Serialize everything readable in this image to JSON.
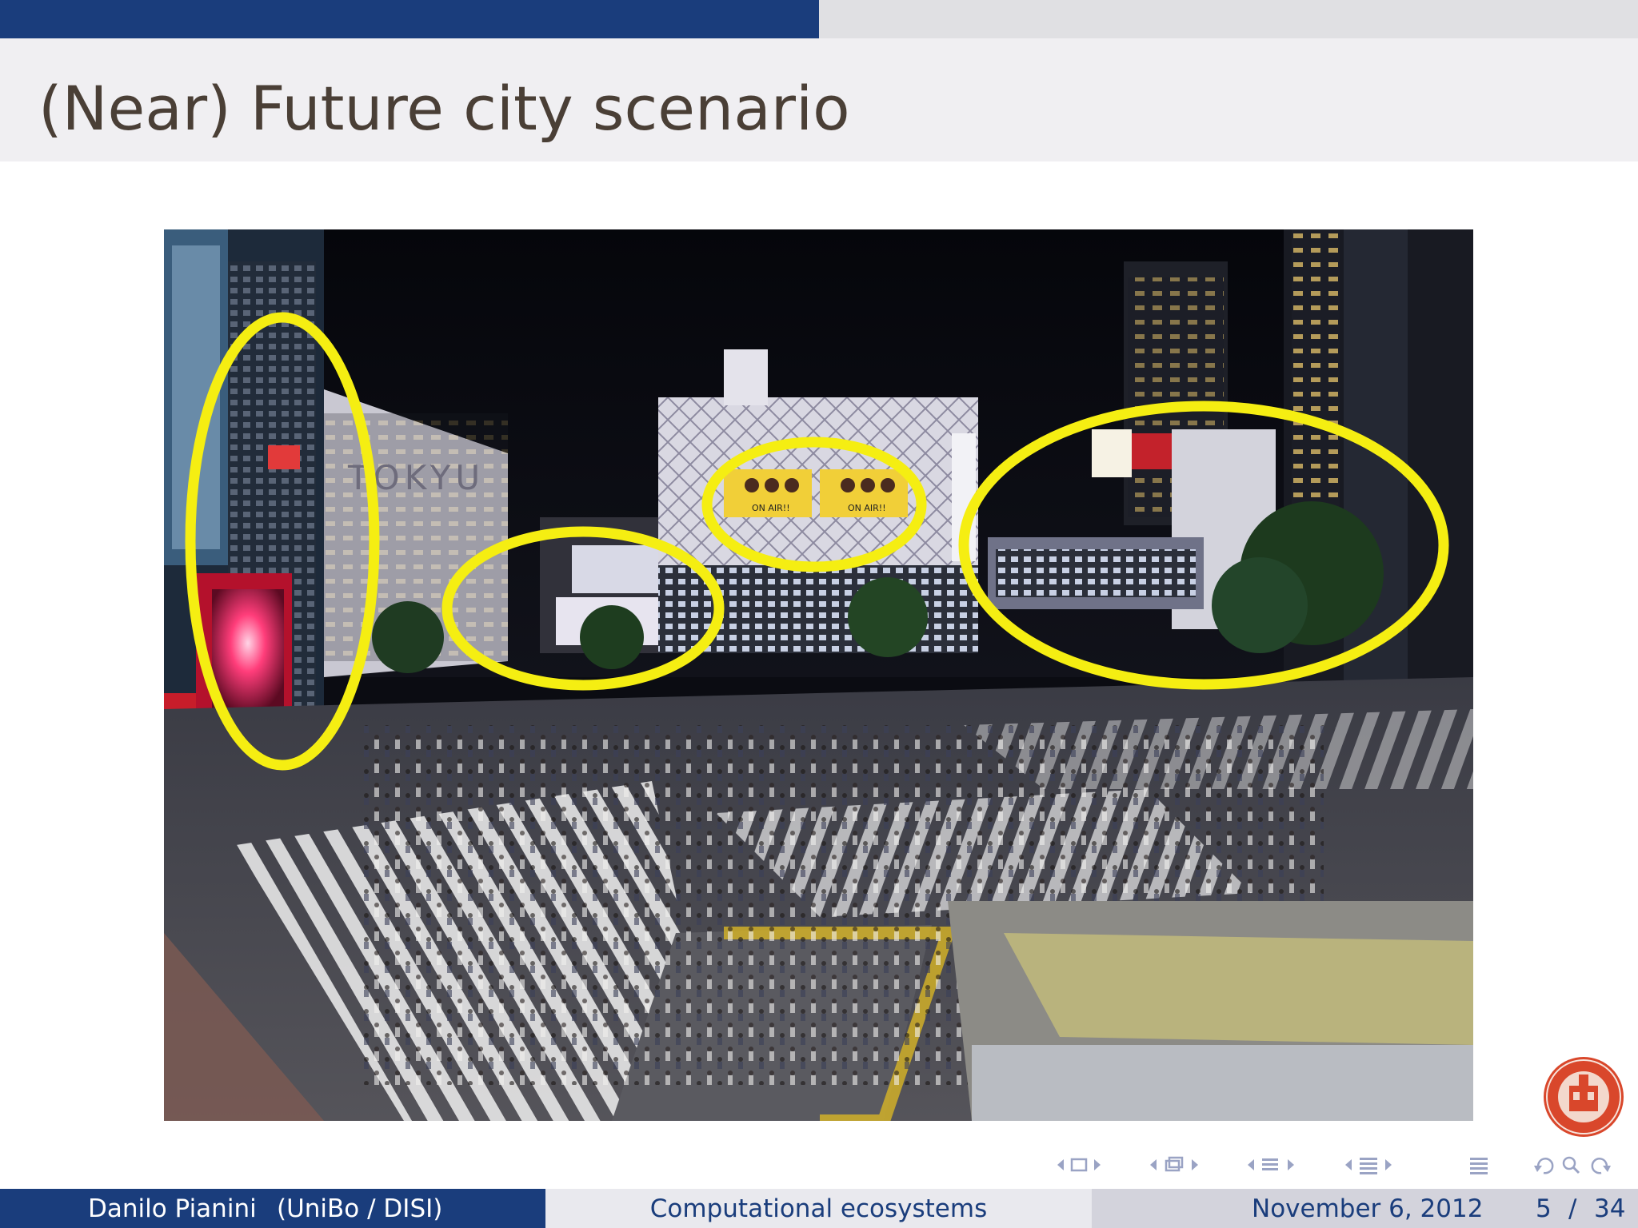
{
  "progress": {
    "fraction": 0.5
  },
  "slide": {
    "title": "(Near) Future city scenario"
  },
  "photo": {
    "ad_board_text": "ON AIR!!",
    "building_sign": "TOKYU",
    "highlight_color": "#f5ee12",
    "highlight_count": 4
  },
  "footer": {
    "author": "Danilo Pianini",
    "affiliation": "(UniBo / DISI)",
    "talk_title": "Computational ecosystems",
    "date": "November 6, 2012",
    "page": {
      "current": "5",
      "separator": "/",
      "total": "34"
    }
  },
  "navigation": {
    "icons": [
      "frame-prev-icon",
      "frame-icon",
      "frame-next-icon",
      "subsection-prev-icon",
      "subsection-icon",
      "subsection-next-icon",
      "section-prev-icon",
      "section-icon",
      "section-next-icon",
      "appendix-prev-icon",
      "appendix-icon",
      "appendix-next-icon",
      "toc-icon",
      "back-icon",
      "search-icon",
      "forward-icon"
    ]
  },
  "theme": {
    "primary": "#1a3d7c",
    "title_text": "#4a3f36",
    "title_band": "#f0eff2",
    "seal_red": "#d9472b"
  }
}
